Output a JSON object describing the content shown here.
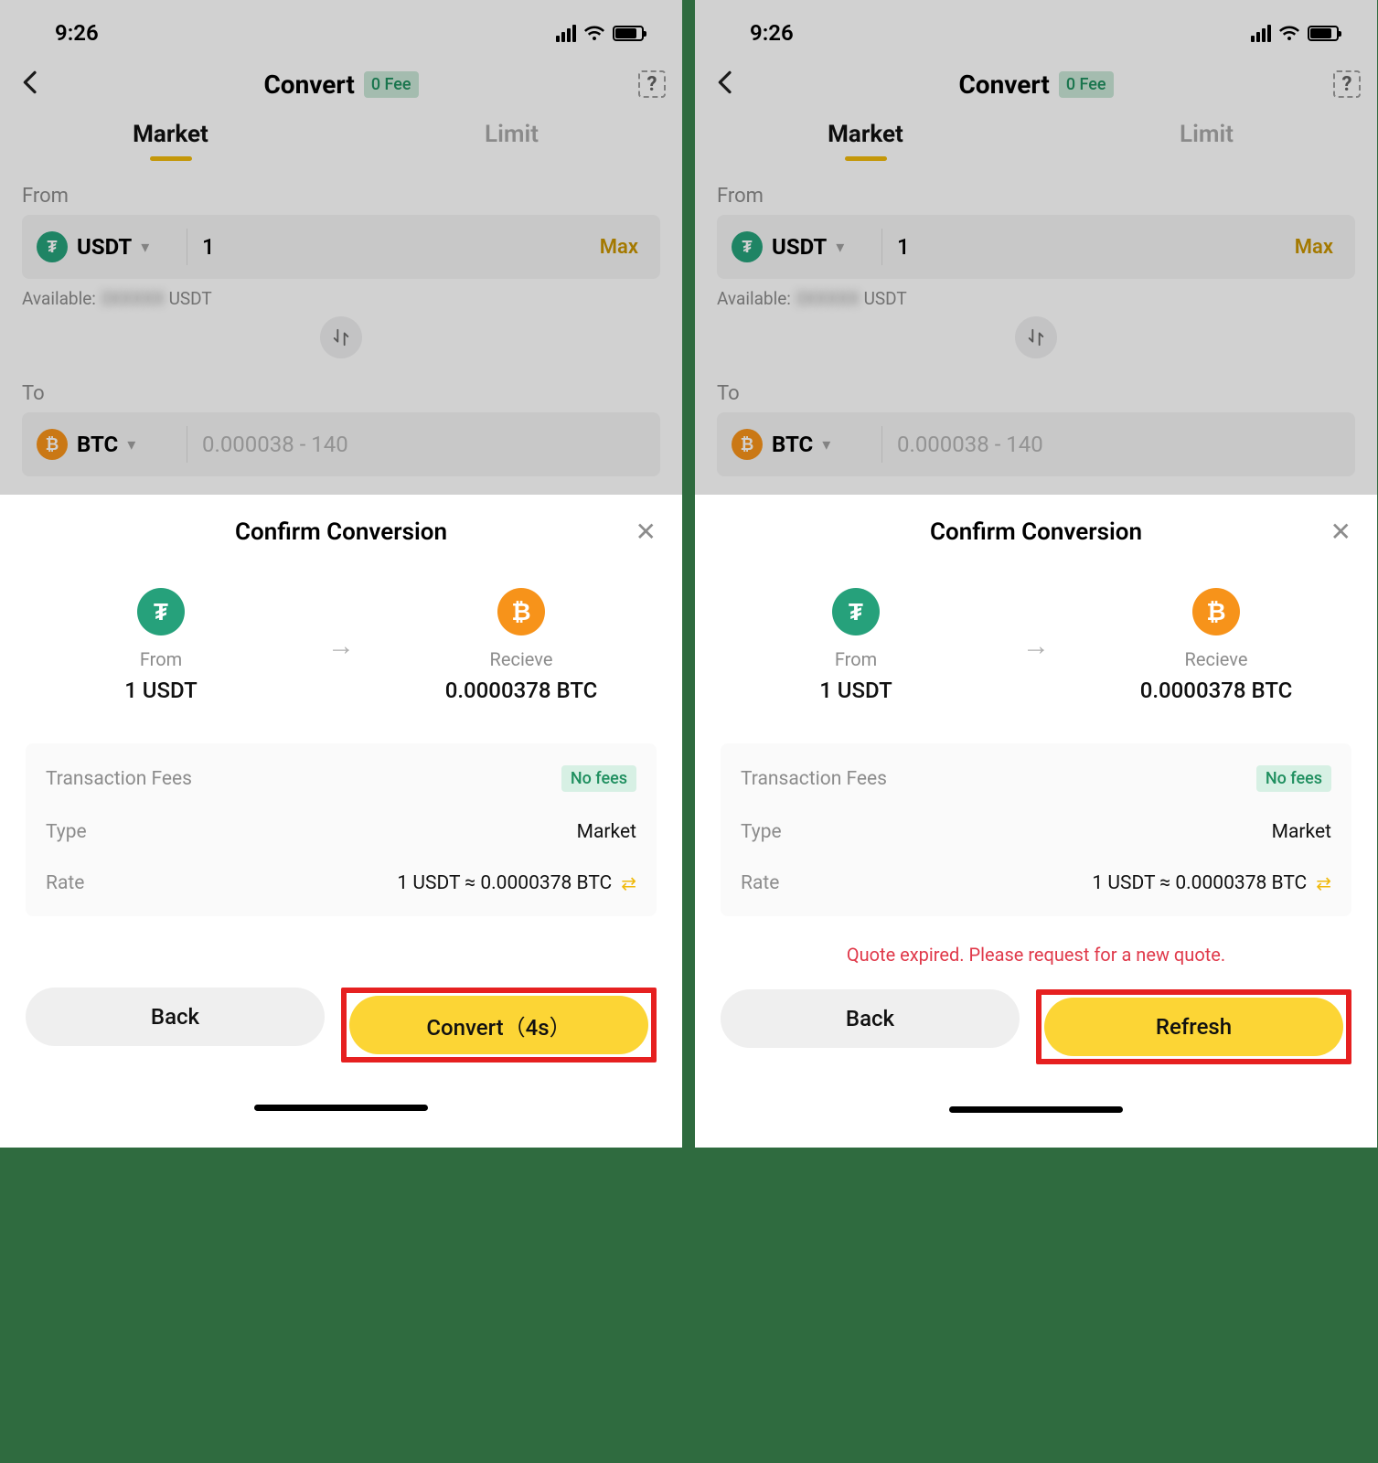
{
  "status": {
    "time": "9:26"
  },
  "nav": {
    "title": "Convert",
    "fee_badge": "0 Fee"
  },
  "tabs": {
    "market": "Market",
    "limit": "Limit"
  },
  "from": {
    "label": "From",
    "symbol": "USDT",
    "amount": "1",
    "max": "Max",
    "available_prefix": "Available:",
    "available_hidden": "3XXXXX",
    "available_unit": "USDT"
  },
  "to": {
    "label": "To",
    "symbol": "BTC",
    "placeholder": "0.000038 - 140"
  },
  "sheet": {
    "title": "Confirm Conversion",
    "from_label": "From",
    "from_value": "1 USDT",
    "receive_label": "Recieve",
    "receive_value": "0.0000378 BTC",
    "fees_label": "Transaction Fees",
    "fees_badge": "No fees",
    "type_label": "Type",
    "type_value": "Market",
    "rate_label": "Rate",
    "rate_value": "1 USDT ≈ 0.0000378 BTC",
    "back": "Back",
    "convert_btn": "Convert（4s）",
    "refresh_btn": "Refresh",
    "error": "Quote expired. Please request for a new quote."
  }
}
